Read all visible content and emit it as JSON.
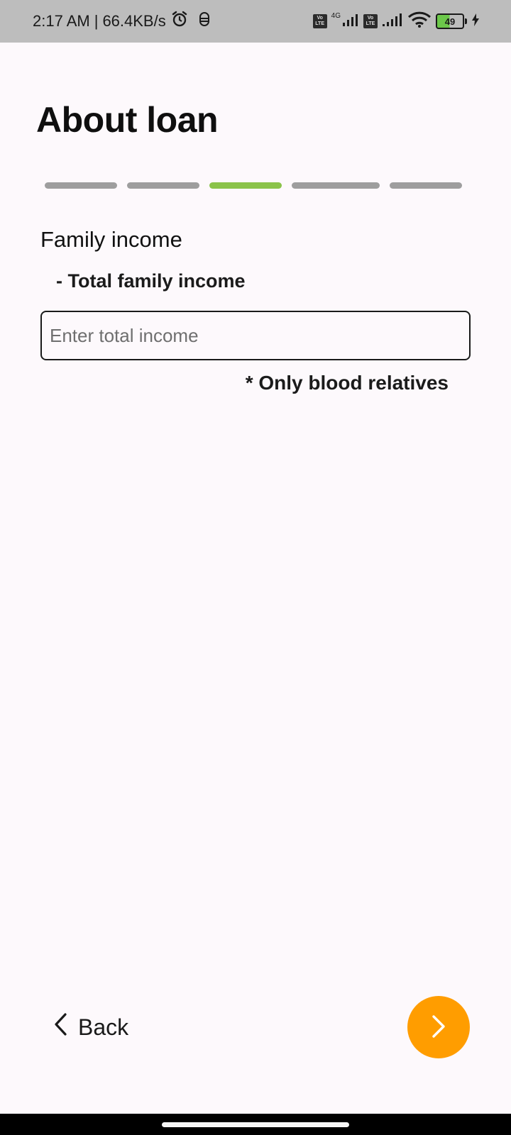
{
  "status_bar": {
    "time": "2:17 AM",
    "net_speed": "66.4KB/s",
    "sim1_badge": [
      "Vo",
      "LTE"
    ],
    "network_type": "4G",
    "sim2_badge": [
      "Vo",
      "LTE"
    ],
    "battery_level": "49",
    "icons": [
      "alarm-icon",
      "notification-icon",
      "signal-icon",
      "wifi-icon",
      "battery-icon",
      "charging-icon"
    ]
  },
  "page": {
    "title": "About loan"
  },
  "progress": {
    "total_steps": 5,
    "current_step": 3,
    "active_color": "#8bc34a",
    "inactive_color": "#9e9e9e"
  },
  "form": {
    "section_title": "Family income",
    "field_label": "- Total family income",
    "input_value": "",
    "input_placeholder": "Enter total income",
    "note": "* Only blood relatives"
  },
  "navigation": {
    "back_label": "Back",
    "next_icon": "chevron-right-icon",
    "next_color": "#ff9d00"
  }
}
